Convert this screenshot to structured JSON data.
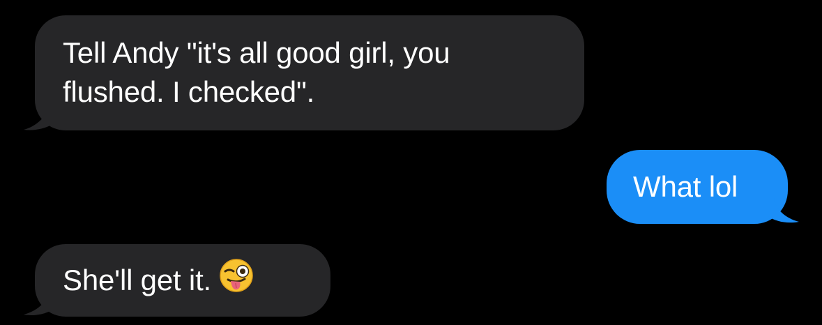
{
  "messages": [
    {
      "direction": "incoming",
      "lines": [
        "Tell Andy \"it's all good girl, you",
        "flushed. I checked\"."
      ]
    },
    {
      "direction": "outgoing",
      "text": "What lol"
    },
    {
      "direction": "incoming",
      "text": "She'll get it.",
      "emoji": "winking-face-with-tongue-emoji"
    }
  ],
  "colors": {
    "background": "#000000",
    "incoming_bubble": "#262628",
    "outgoing_bubble": "#1b8ef7",
    "text": "#ffffff"
  }
}
